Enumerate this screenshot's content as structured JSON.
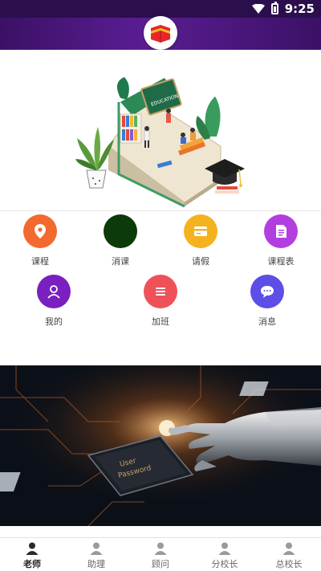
{
  "status_bar": {
    "time": "9:25"
  },
  "menu": [
    {
      "label": "课程",
      "icon": "location-pin-icon",
      "color": "#f26a2e"
    },
    {
      "label": "消课",
      "icon": "dark-circle-icon",
      "color": "#0c3a08"
    },
    {
      "label": "请假",
      "icon": "card-icon",
      "color": "#f5b21f"
    },
    {
      "label": "课程表",
      "icon": "document-icon",
      "color": "#b33ee0"
    },
    {
      "label": "我的",
      "icon": "person-icon",
      "color": "#7a1fc0"
    },
    {
      "label": "加班",
      "icon": "list-icon",
      "color": "#ee5158"
    },
    {
      "label": "消息",
      "icon": "chat-bubble-icon",
      "color": "#5c4ee6"
    }
  ],
  "hero_text": "EDUCATION",
  "banner_text": [
    "User",
    "Password"
  ],
  "tabs": [
    {
      "label": "老师",
      "active": true
    },
    {
      "label": "助理",
      "active": false
    },
    {
      "label": "顾问",
      "active": false
    },
    {
      "label": "分校长",
      "active": false
    },
    {
      "label": "总校长",
      "active": false
    }
  ]
}
